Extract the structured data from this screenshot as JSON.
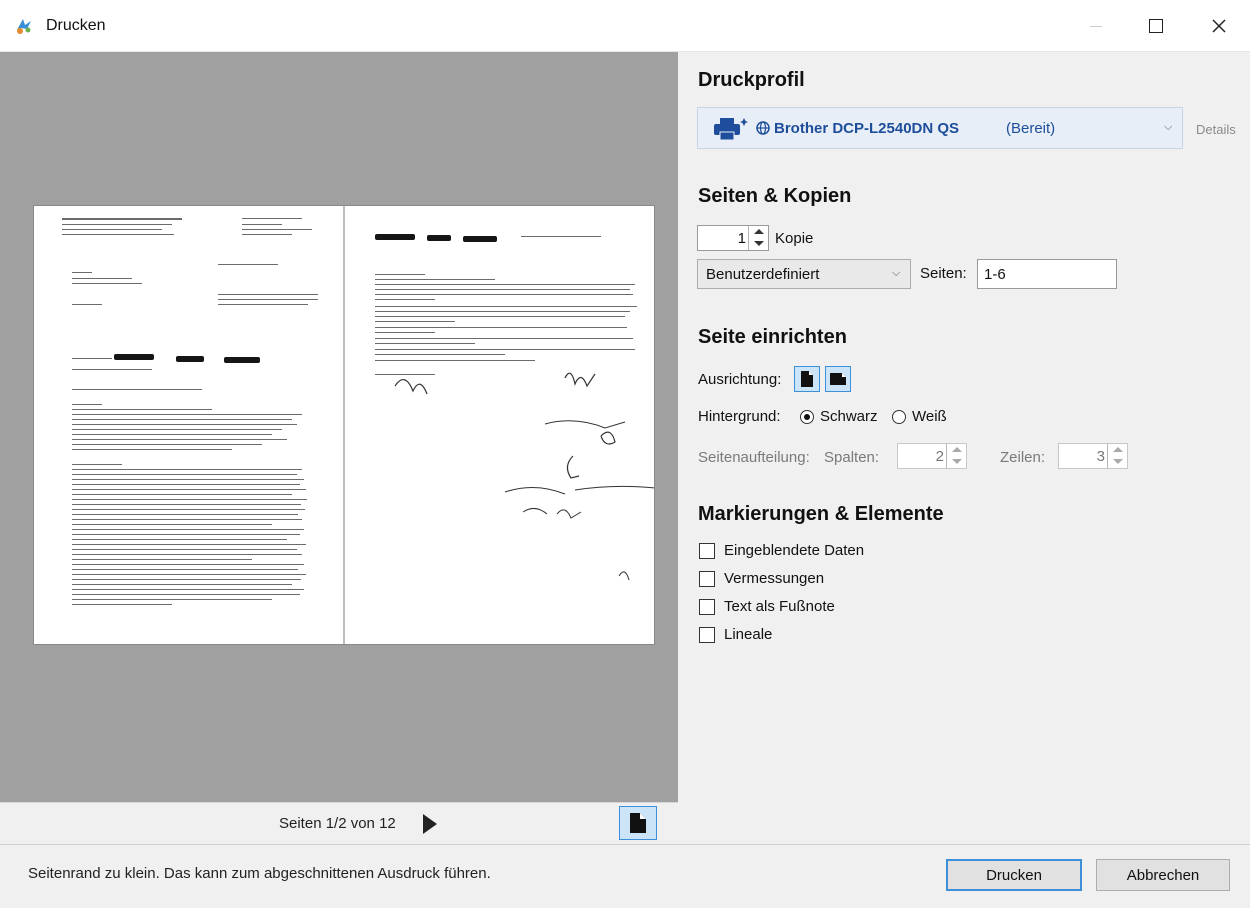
{
  "window": {
    "title": "Drucken"
  },
  "preview": {
    "pager_label": "Seiten 1/2 von 12"
  },
  "panel": {
    "druckprofil": {
      "title": "Druckprofil",
      "printer_name": "Brother DCP-L2540DN QS",
      "printer_status": "(Bereit)",
      "details_label": "Details"
    },
    "seiten_kopien": {
      "title": "Seiten & Kopien",
      "copies_value": "1",
      "copies_label": "Kopie",
      "range_mode": "Benutzerdefiniert",
      "pages_label": "Seiten:",
      "pages_value": "1-6"
    },
    "seite_einrichten": {
      "title": "Seite einrichten",
      "orientation_label": "Ausrichtung:",
      "background_label": "Hintergrund:",
      "background_options": [
        "Schwarz",
        "Weiß"
      ],
      "background_selected": "Schwarz",
      "layout_label": "Seitenaufteilung:",
      "columns_label": "Spalten:",
      "columns_value": "2",
      "rows_label": "Zeilen:",
      "rows_value": "3"
    },
    "markierungen": {
      "title": "Markierungen & Elemente",
      "items": [
        {
          "label": "Eingeblendete Daten",
          "checked": false
        },
        {
          "label": "Vermessungen",
          "checked": false
        },
        {
          "label": "Text als Fußnote",
          "checked": false
        },
        {
          "label": "Lineale",
          "checked": false
        }
      ]
    }
  },
  "footer": {
    "warning": "Seitenrand zu klein.  Das kann zum abgeschnittenen Ausdruck führen.",
    "print_button": "Drucken",
    "cancel_button": "Abbrechen"
  },
  "colors": {
    "accent": "#3d8fd9",
    "printer_text": "#1e4e9b",
    "preview_bg": "#a0a0a0"
  }
}
